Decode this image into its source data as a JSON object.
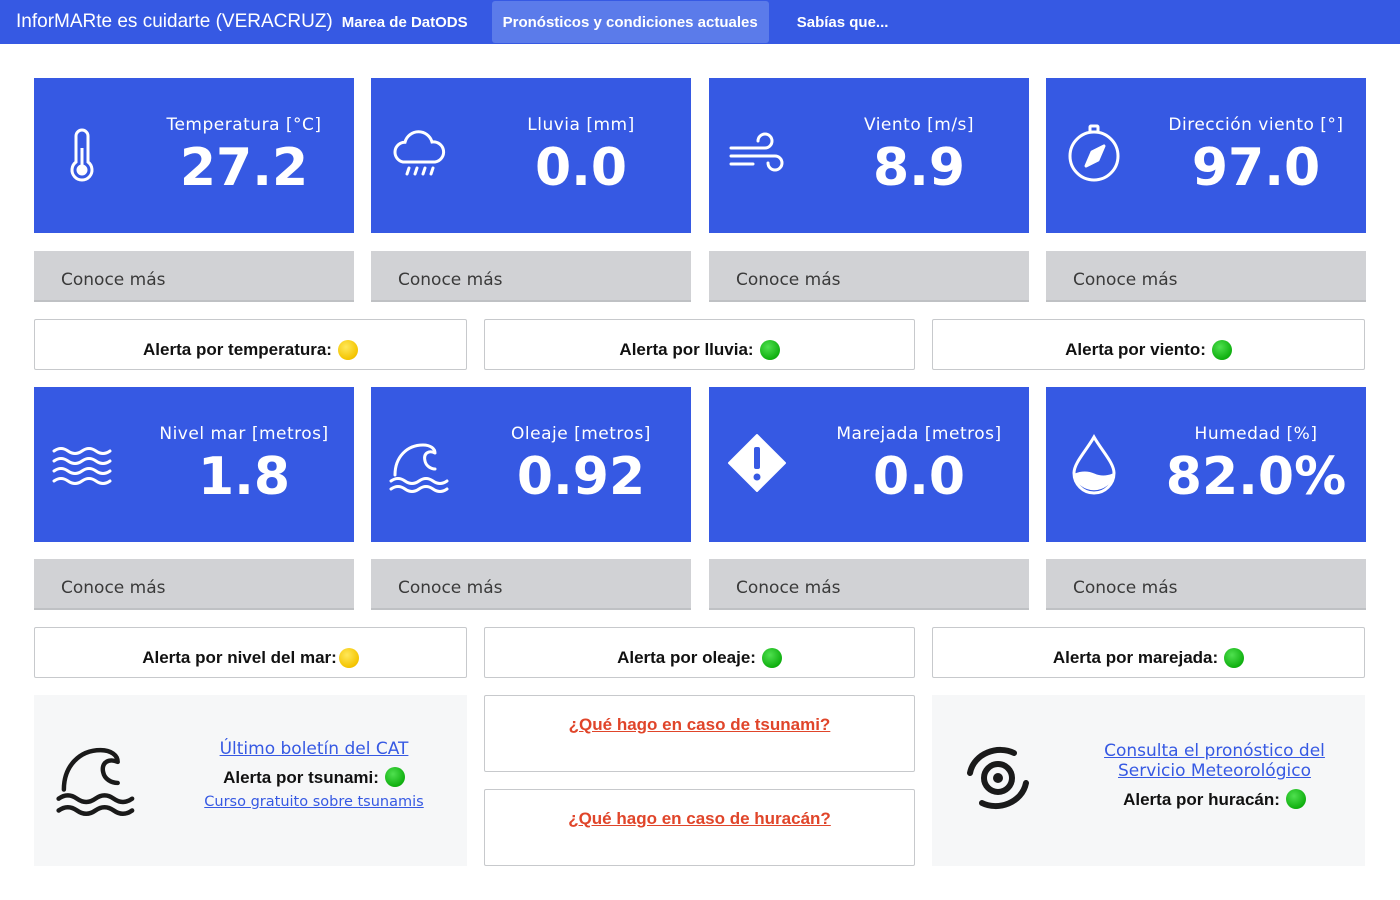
{
  "nav": {
    "brand": "InforMARte es cuidarte (VERACRUZ)",
    "brand_sub": "Marea de DatODS",
    "links": [
      {
        "label": "Pronósticos y condiciones actuales",
        "active": true
      },
      {
        "label": "Sabías que...",
        "active": false
      }
    ]
  },
  "metrics": [
    {
      "label": "Temperatura [°C]",
      "value": "27.2",
      "icon": "thermometer-icon"
    },
    {
      "label": "Lluvia [mm]",
      "value": "0.0",
      "icon": "rain-cloud-icon"
    },
    {
      "label": "Viento [m/s]",
      "value": "8.9",
      "icon": "wind-icon"
    },
    {
      "label": "Dirección viento [°]",
      "value": "97.0",
      "icon": "compass-icon"
    },
    {
      "label": "Nivel mar [metros]",
      "value": "1.8",
      "icon": "water-waves-icon"
    },
    {
      "label": "Oleaje [metros]",
      "value": "0.92",
      "icon": "wave-icon"
    },
    {
      "label": "Marejada [metros]",
      "value": "0.0",
      "icon": "warning-diamond-icon"
    },
    {
      "label": "Humedad [%]",
      "value": "82.0%",
      "icon": "droplet-icon"
    }
  ],
  "more_label": "Conoce más",
  "alerts_row1": [
    {
      "label": "Alerta por temperatura:",
      "status": "yellow"
    },
    {
      "label": "Alerta por lluvia:",
      "status": "green"
    },
    {
      "label": "Alerta por viento:",
      "status": "green"
    }
  ],
  "alerts_row2": [
    {
      "label": "Alerta por nivel del mar:",
      "status": "yellow"
    },
    {
      "label": "Alerta por oleaje:",
      "status": "green"
    },
    {
      "label": "Alerta por marejada:",
      "status": "green"
    }
  ],
  "tsunami": {
    "bulletin_link": "Último boletín del CAT",
    "alert_label": "Alerta por tsunami:",
    "alert_status": "green",
    "course_link": "Curso gratuito sobre tsunamis",
    "icon": "tsunami-wave-icon"
  },
  "questions": {
    "tsunami": "¿Qué hago en caso de tsunami?",
    "hurricane": "¿Qué hago en caso de huracán?"
  },
  "hurricane": {
    "forecast_link_line1": "Consulta el pronóstico del",
    "forecast_link_line2": "Servicio Meteorológico",
    "alert_label": "Alerta por huracán:",
    "alert_status": "green",
    "icon": "hurricane-icon"
  },
  "colors": {
    "primary": "#3659e3",
    "alert_yellow": "#f4c400",
    "alert_green": "#10b010",
    "question_link": "#e0452a"
  }
}
